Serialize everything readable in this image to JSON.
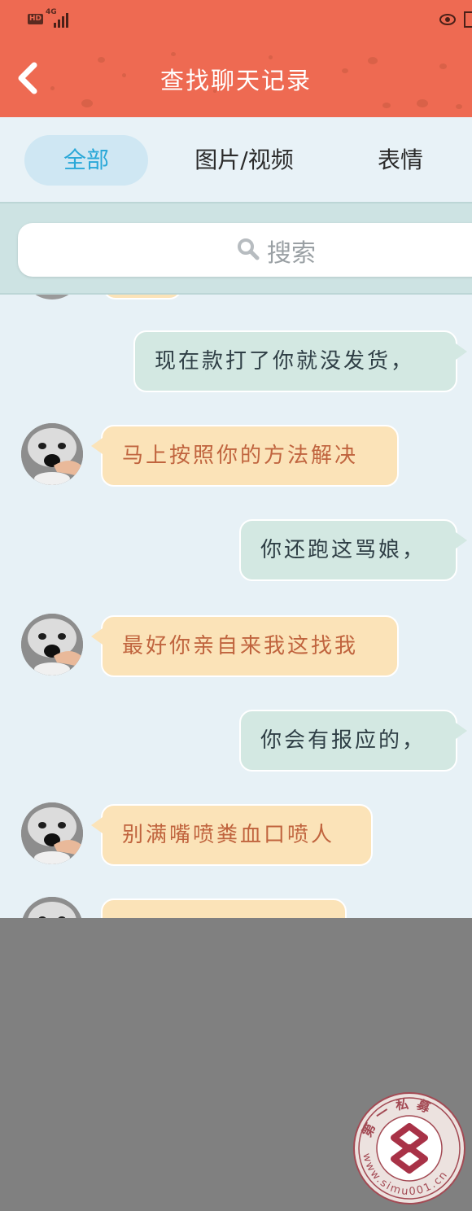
{
  "status_bar": {
    "hd_badge": "HD",
    "network": "4G",
    "icons": [
      "hd-icon",
      "signal-icon",
      "eye-icon",
      "battery-icon"
    ]
  },
  "header": {
    "title": "查找聊天记录",
    "back_icon": "chevron-left-icon",
    "background_color": "#ee6a52"
  },
  "tabs": [
    {
      "label": "全部",
      "active": true
    },
    {
      "label": "图片/视频",
      "active": false
    },
    {
      "label": "表情",
      "active": false
    }
  ],
  "search": {
    "placeholder": "搜索",
    "icon": "search-icon"
  },
  "messages": [
    {
      "side": "out",
      "text": "现在款打了你就没发货，"
    },
    {
      "side": "in",
      "text": "马上按照你的方法解决"
    },
    {
      "side": "out",
      "text": "你还跑这骂娘，"
    },
    {
      "side": "in",
      "text": "最好你亲自来我这找我"
    },
    {
      "side": "out",
      "text": "你会有报应的，"
    },
    {
      "side": "in",
      "text": "别满嘴喷粪血口喷人"
    }
  ],
  "watermark": {
    "top_text": "第一私募",
    "bottom_text": "www.simu001.cn"
  },
  "colors": {
    "accent": "#2aa8d8",
    "outgoing_bubble": "#d3e8e2",
    "incoming_bubble": "#fbe3b8",
    "incoming_text": "#c0643e"
  }
}
